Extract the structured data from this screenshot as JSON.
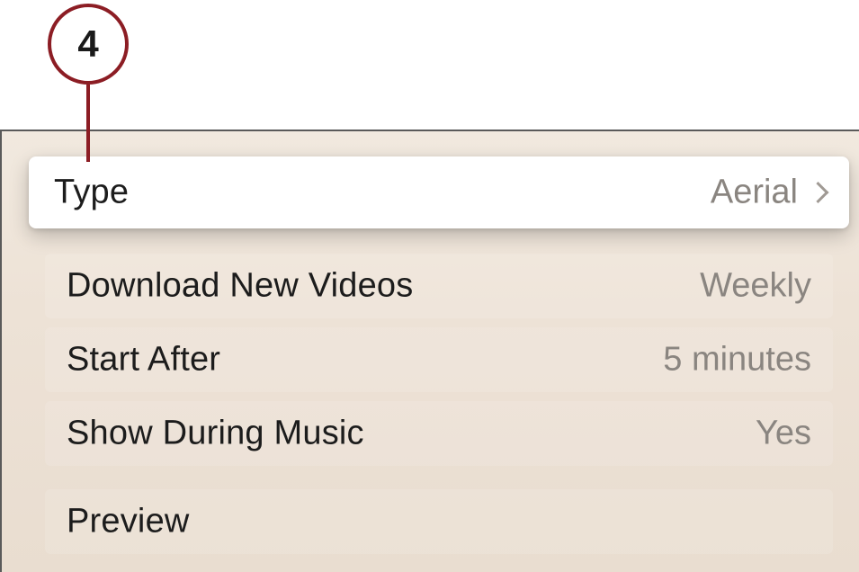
{
  "callout": {
    "number": "4"
  },
  "settings": {
    "rows": [
      {
        "label": "Type",
        "value": "Aerial",
        "selected": true
      },
      {
        "label": "Download New Videos",
        "value": "Weekly"
      },
      {
        "label": "Start After",
        "value": "5 minutes"
      },
      {
        "label": "Show During Music",
        "value": "Yes"
      },
      {
        "label": "Preview",
        "value": ""
      }
    ]
  },
  "colors": {
    "callout": "#8c1d24",
    "background": "#ede2d6",
    "label": "#1c1c1c",
    "value": "#8a8580"
  },
  "icons": {
    "disclosure": "chevron-right-icon"
  }
}
